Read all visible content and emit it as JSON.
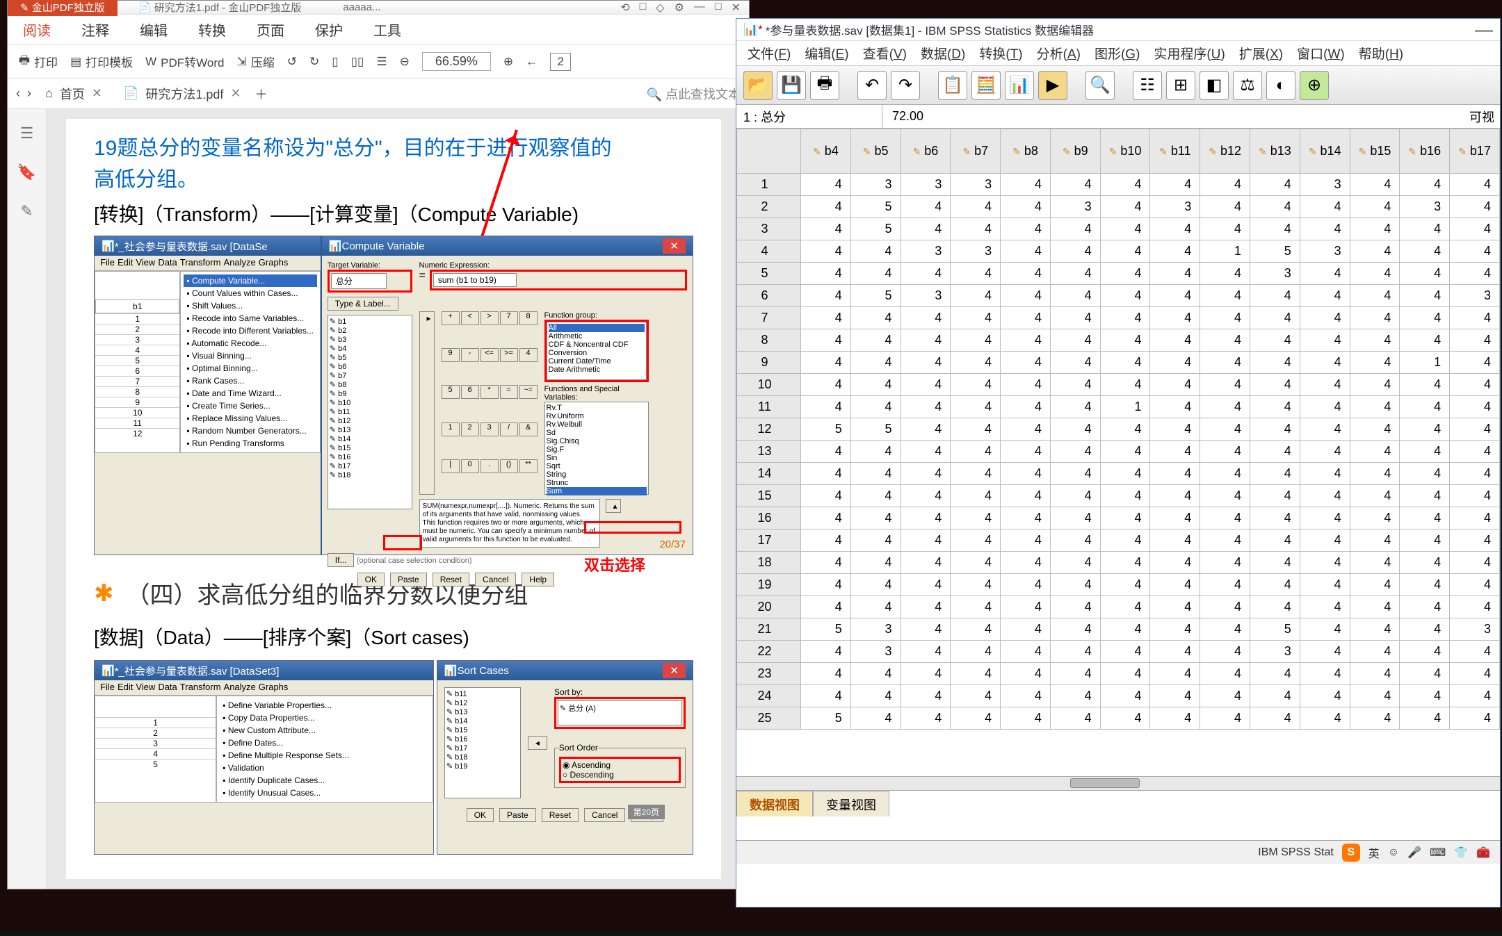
{
  "pdf": {
    "app_name": "金山PDF独立版",
    "title_tabs": [
      "研究方法1.pdf - 金山PDF独立版",
      "aaaaa..."
    ],
    "win_icons": [
      "⟲",
      "□",
      "◇",
      "⚙",
      "—",
      "□",
      "✕"
    ],
    "menu": [
      "阅读",
      "注释",
      "编辑",
      "转换",
      "页面",
      "保护",
      "工具"
    ],
    "toolbar": {
      "print": "打印",
      "tmpl": "打印模板",
      "toword": "PDF转Word",
      "compress": "压缩",
      "zoom": "66.59%",
      "page": "2"
    },
    "tabs": {
      "home": "首页",
      "doc": "研究方法1.pdf",
      "search_ph": "点此查找文本"
    },
    "doc": {
      "line1": "19题总分的变量名称设为\"总分\"，目的在于进行观察值的",
      "line2": "高低分组。",
      "line3": "[转换]（Transform）——[计算变量]（Compute Variable)",
      "sav_title1": "*_社会参与量表数据.sav [DataSe",
      "compute_title": "Compute Variable",
      "sav_menus": [
        "File",
        "Edit",
        "View",
        "Data",
        "Transform",
        "Analyze",
        "Graphs"
      ],
      "transform_menu": [
        "Compute Variable...",
        "Count Values within Cases...",
        "Shift Values...",
        "Recode into Same Variables...",
        "Recode into Different Variables...",
        "Automatic Recode...",
        "Visual Binning...",
        "Optimal Binning...",
        "Rank Cases...",
        "Date and Time Wizard...",
        "Create Time Series...",
        "Replace Missing Values...",
        "Random Number Generators...",
        "Run Pending Transforms"
      ],
      "target_label": "Target Variable:",
      "target_val": "总分",
      "type_label": "Type & Label...",
      "numexp_label": "Numeric Expression:",
      "numexp_val": "sum (b1 to b19)",
      "func_group": "Function group:",
      "func_groups": [
        "All",
        "Arithmetic",
        "CDF & Noncentral CDF",
        "Conversion",
        "Current Date/Time",
        "Date Arithmetic"
      ],
      "func_special": "Functions and Special Variables:",
      "funcs": [
        "Rv.T",
        "Rv.Uniform",
        "Rv.Weibull",
        "Sd",
        "Sig.Chisq",
        "Sig.F",
        "Sin",
        "Sqrt",
        "String",
        "Strunc",
        "Sum"
      ],
      "vars": [
        "b1",
        "b2",
        "b3",
        "b4",
        "b5",
        "b6",
        "b7",
        "b8",
        "b9",
        "b10",
        "b11",
        "b12",
        "b13",
        "b14",
        "b15",
        "b16",
        "b17",
        "b18"
      ],
      "help_text": "SUM(numexpr,numexpr[,...]). Numeric. Returns the sum of its arguments that have valid, nonmissing values. This function requires two or more arguments, which must be numeric. You can specify a minimum number of valid arguments for this function to be evaluated.",
      "if_label": "If...",
      "if_desc": "(optional case selection condition)",
      "dbl_click": "双击选择",
      "dlg_btns": [
        "OK",
        "Paste",
        "Reset",
        "Cancel",
        "Help"
      ],
      "page_ind": "20/37",
      "sect4": "（四）求高低分组的临界分数以便分组",
      "sect4_line": "[数据]（Data）——[排序个案]（Sort cases)",
      "sav_title2": "*_社会参与量表数据.sav [DataSet3]",
      "sort_title": "Sort Cases",
      "data_menu": [
        "Define Variable Properties...",
        "Copy Data Properties...",
        "New Custom Attribute...",
        "Define Dates...",
        "Define Multiple Response Sets...",
        "Validation",
        "Identify Duplicate Cases...",
        "Identify Unusual Cases..."
      ],
      "sort_vars": [
        "b11",
        "b12",
        "b13",
        "b14",
        "b15",
        "b16",
        "b17",
        "b18",
        "b19"
      ],
      "sort_by": "Sort by:",
      "sort_sel": "总分 (A)",
      "sort_order": "Sort Order",
      "asc": "Ascending",
      "desc": "Descending",
      "page_ind2": "第20页"
    }
  },
  "spss": {
    "title": "*参与量表数据.sav [数据集1] - IBM SPSS Statistics 数据编辑器",
    "menu": [
      {
        "t": "文件",
        "u": "F"
      },
      {
        "t": "编辑",
        "u": "E"
      },
      {
        "t": "查看",
        "u": "V"
      },
      {
        "t": "数据",
        "u": "D"
      },
      {
        "t": "转换",
        "u": "T"
      },
      {
        "t": "分析",
        "u": "A"
      },
      {
        "t": "图形",
        "u": "G"
      },
      {
        "t": "实用程序",
        "u": "U"
      },
      {
        "t": "扩展",
        "u": "X"
      },
      {
        "t": "窗口",
        "u": "W"
      },
      {
        "t": "帮助",
        "u": "H"
      }
    ],
    "cell_name": "1 : 总分",
    "cell_val": "72.00",
    "vis": "可视",
    "cols": [
      "b4",
      "b5",
      "b6",
      "b7",
      "b8",
      "b9",
      "b10",
      "b11",
      "b12",
      "b13",
      "b14",
      "b15",
      "b16",
      "b17"
    ],
    "rows": [
      [
        4,
        3,
        3,
        3,
        4,
        4,
        4,
        4,
        4,
        4,
        3,
        4,
        4,
        4
      ],
      [
        4,
        5,
        4,
        4,
        4,
        3,
        4,
        3,
        4,
        4,
        4,
        4,
        3,
        4
      ],
      [
        4,
        5,
        4,
        4,
        4,
        4,
        4,
        4,
        4,
        4,
        4,
        4,
        4,
        4
      ],
      [
        4,
        4,
        3,
        3,
        4,
        4,
        4,
        4,
        1,
        5,
        3,
        4,
        4,
        4
      ],
      [
        4,
        4,
        4,
        4,
        4,
        4,
        4,
        4,
        4,
        3,
        4,
        4,
        4,
        4
      ],
      [
        4,
        5,
        3,
        4,
        4,
        4,
        4,
        4,
        4,
        4,
        4,
        4,
        4,
        3
      ],
      [
        4,
        4,
        4,
        4,
        4,
        4,
        4,
        4,
        4,
        4,
        4,
        4,
        4,
        4
      ],
      [
        4,
        4,
        4,
        4,
        4,
        4,
        4,
        4,
        4,
        4,
        4,
        4,
        4,
        4
      ],
      [
        4,
        4,
        4,
        4,
        4,
        4,
        4,
        4,
        4,
        4,
        4,
        4,
        1,
        4
      ],
      [
        4,
        4,
        4,
        4,
        4,
        4,
        4,
        4,
        4,
        4,
        4,
        4,
        4,
        4
      ],
      [
        4,
        4,
        4,
        4,
        4,
        4,
        1,
        4,
        4,
        4,
        4,
        4,
        4,
        4
      ],
      [
        5,
        5,
        4,
        4,
        4,
        4,
        4,
        4,
        4,
        4,
        4,
        4,
        4,
        4
      ],
      [
        4,
        4,
        4,
        4,
        4,
        4,
        4,
        4,
        4,
        4,
        4,
        4,
        4,
        4
      ],
      [
        4,
        4,
        4,
        4,
        4,
        4,
        4,
        4,
        4,
        4,
        4,
        4,
        4,
        4
      ],
      [
        4,
        4,
        4,
        4,
        4,
        4,
        4,
        4,
        4,
        4,
        4,
        4,
        4,
        4
      ],
      [
        4,
        4,
        4,
        4,
        4,
        4,
        4,
        4,
        4,
        4,
        4,
        4,
        4,
        4
      ],
      [
        4,
        4,
        4,
        4,
        4,
        4,
        4,
        4,
        4,
        4,
        4,
        4,
        4,
        4
      ],
      [
        4,
        4,
        4,
        4,
        4,
        4,
        4,
        4,
        4,
        4,
        4,
        4,
        4,
        4
      ],
      [
        4,
        4,
        4,
        4,
        4,
        4,
        4,
        4,
        4,
        4,
        4,
        4,
        4,
        4
      ],
      [
        4,
        4,
        4,
        4,
        4,
        4,
        4,
        4,
        4,
        4,
        4,
        4,
        4,
        4
      ],
      [
        5,
        3,
        4,
        4,
        4,
        4,
        4,
        4,
        4,
        5,
        4,
        4,
        4,
        3
      ],
      [
        4,
        3,
        4,
        4,
        4,
        4,
        4,
        4,
        4,
        3,
        4,
        4,
        4,
        4
      ],
      [
        4,
        4,
        4,
        4,
        4,
        4,
        4,
        4,
        4,
        4,
        4,
        4,
        4,
        4
      ],
      [
        4,
        4,
        4,
        4,
        4,
        4,
        4,
        4,
        4,
        4,
        4,
        4,
        4,
        4
      ],
      [
        5,
        4,
        4,
        4,
        4,
        4,
        4,
        4,
        4,
        4,
        4,
        4,
        4,
        4
      ]
    ],
    "tabs": [
      "数据视图",
      "变量视图"
    ],
    "status": "IBM SPSS Stat",
    "ime": "英"
  }
}
